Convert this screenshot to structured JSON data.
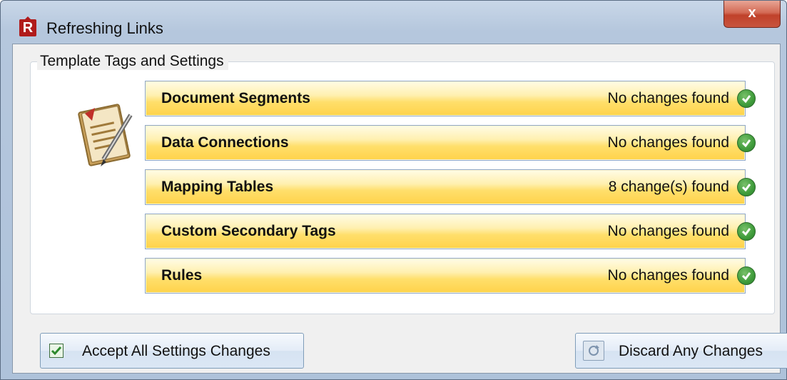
{
  "window": {
    "title": "Refreshing Links",
    "app_icon_letter": "R",
    "close_glyph": "x"
  },
  "group": {
    "label": "Template Tags and Settings",
    "icon": "document-edit-icon"
  },
  "rows": [
    {
      "name": "Document Segments",
      "status": "No changes found",
      "status_icon": "check-circle-icon"
    },
    {
      "name": "Data Connections",
      "status": "No changes found",
      "status_icon": "check-circle-icon"
    },
    {
      "name": "Mapping Tables",
      "status": "8 change(s) found",
      "status_icon": "check-circle-icon"
    },
    {
      "name": "Custom Secondary Tags",
      "status": "No changes found",
      "status_icon": "check-circle-icon"
    },
    {
      "name": "Rules",
      "status": "No changes found",
      "status_icon": "check-circle-icon"
    }
  ],
  "buttons": {
    "accept_label": "Accept All Settings Changes",
    "discard_label": "Discard Any Changes"
  },
  "colors": {
    "row_gold": "#ffd24a",
    "check_green": "#3e9b3a",
    "close_red": "#c0412a"
  }
}
